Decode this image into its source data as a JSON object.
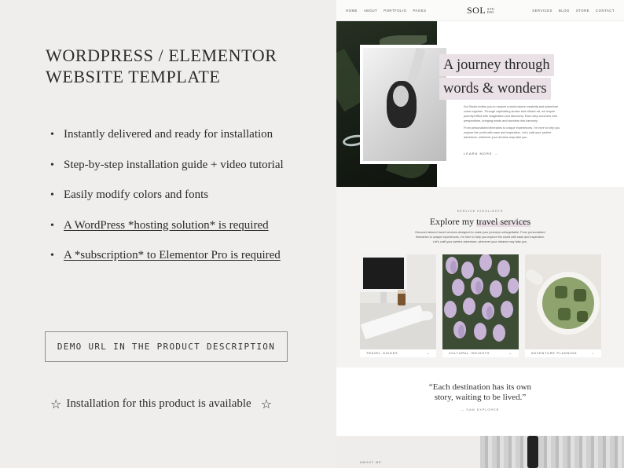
{
  "left": {
    "title": "WORDPRESS / ELEMENTOR WEBSITE TEMPLATE",
    "features": [
      "Instantly delivered and ready for installation",
      "Step-by-step installation guide + video tutorial",
      "Easily modify colors and fonts",
      "A WordPress *hosting solution* is required",
      "A *subscription* to Elementor Pro is required"
    ],
    "demo_button": "DEMO URL IN THE PRODUCT DESCRIPTION",
    "installation_note": "Installation for this product is available",
    "star_glyph": "☆"
  },
  "site": {
    "nav_left": [
      "HOME",
      "ABOUT",
      "PORTFOLIO",
      "PAGES"
    ],
    "logo": "SOL",
    "logo_sub": "STU DIO",
    "nav_right": [
      "SERVICES",
      "BLOG",
      "STORE",
      "CONTACT"
    ],
    "hero": {
      "title_line1": "A journey through",
      "title_line2": "words & wonders",
      "paragraph1": "Sol Studio invites you to explore a world where creativity and adventure come together. Through captivating stories and vibrant art, we inspire journeys filled with imagination and discovery. Each step uncovers new perspectives, bringing words and wonders into harmony.",
      "paragraph2": "From personalized itineraries to unique experiences, I'm here to help you explore the world with ease and inspiration. Let's craft your perfect adventure, wherever your dreams may take you.",
      "cta": "LEARN MORE →"
    },
    "services": {
      "eyebrow": "SERVICE HIGHLIGHTS",
      "title_pre": "Explore my ",
      "title_highlight": "travel services",
      "description": "Discover tailored travel services designed to make your journeys unforgettable. From personalized itineraries to unique experiences, I'm here to help you explore the world with ease and inspiration. Let's craft your perfect adventure, wherever your dreams may take you.",
      "cards": [
        {
          "label": "TRAVEL GUIDES",
          "arrow": "→"
        },
        {
          "label": "CULTURAL INSIGHTS",
          "arrow": "→"
        },
        {
          "label": "ADVENTURE PLANNING",
          "arrow": "→"
        }
      ]
    },
    "quote": {
      "text_line1": "“Each destination has its own",
      "text_line2": "story, waiting to be lived.”",
      "author": "— SAM EXPLORER"
    },
    "about_label": "ABOUT ME"
  }
}
